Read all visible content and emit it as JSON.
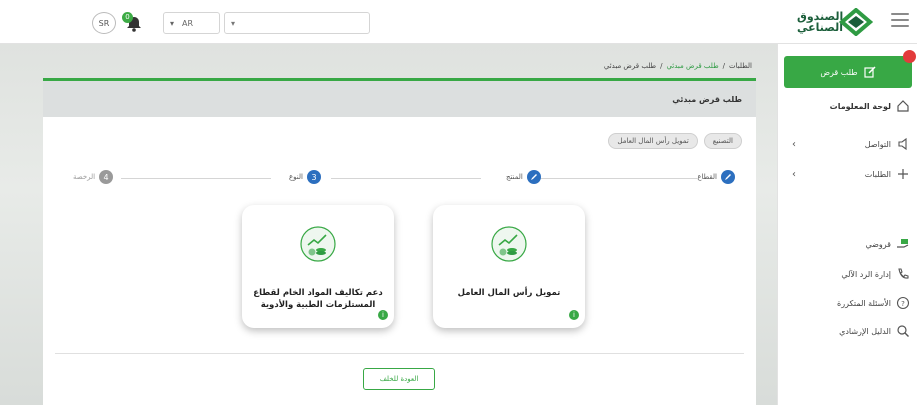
{
  "header": {
    "logo_text_line1": "الصندوق",
    "logo_text_line2": "الصناعي",
    "language": "AR",
    "currency_badge": "SR",
    "notification_count": "0"
  },
  "sidebar": {
    "new_request": "طلب قرض",
    "items": [
      {
        "label": "لوحة المعلومات",
        "icon": "home-icon",
        "has_chevron": false
      },
      {
        "label": "التواصل",
        "icon": "megaphone-icon",
        "has_chevron": true
      },
      {
        "label": "الطلبات",
        "icon": "plus-icon",
        "has_chevron": true
      },
      {
        "label": "قروضي",
        "icon": "hand-money-icon",
        "has_chevron": false
      },
      {
        "label": "إدارة الرد الآلي",
        "icon": "phone-icon",
        "has_chevron": false
      },
      {
        "label": "الأسئلة المتكررة",
        "icon": "question-icon",
        "has_chevron": false
      },
      {
        "label": "الدليل الإرشادي",
        "icon": "search-icon",
        "has_chevron": false
      }
    ]
  },
  "breadcrumb": {
    "root": "الطلبات",
    "parent": "طلب قرض مبدئي",
    "current": "طلب قرض مبدئي",
    "separator": "/"
  },
  "main": {
    "card_title": "طلب قرض مبدئي",
    "chips": [
      "التصنيع",
      "تمويل رأس المال العامل"
    ],
    "steps": [
      {
        "num": "",
        "label": "القطاع",
        "state": "done"
      },
      {
        "num": "",
        "label": "المنتج",
        "state": "done"
      },
      {
        "num": "3",
        "label": "النوع",
        "state": "active"
      },
      {
        "num": "4",
        "label": "الرخصة",
        "state": "pending"
      }
    ],
    "options": [
      {
        "title": "تمويل رأس المال العامل"
      },
      {
        "title": "دعم تكاليف المواد الخام لقطاع المستلزمات الطبية والأدوية"
      }
    ],
    "back_button": "العودة للخلف"
  },
  "colors": {
    "brand_green": "#38a845",
    "step_blue": "#2c6fbf",
    "alert_red": "#e23b3b"
  }
}
